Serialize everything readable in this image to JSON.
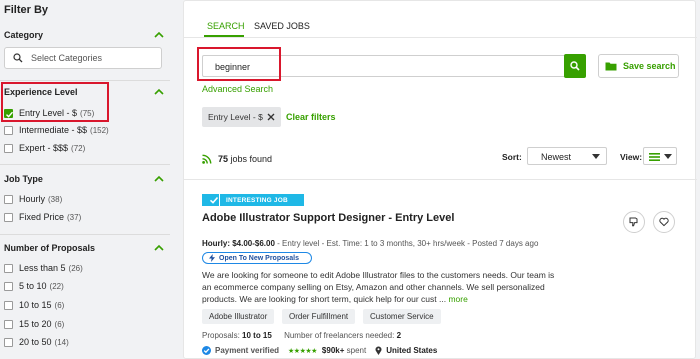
{
  "sidebar": {
    "title": "Filter By",
    "category": {
      "heading": "Category",
      "placeholder": "Select Categories"
    },
    "experience": {
      "heading": "Experience Level",
      "options": [
        {
          "label": "Entry Level - $",
          "count": "(75)",
          "checked": true
        },
        {
          "label": "Intermediate - $$",
          "count": "(152)",
          "checked": false
        },
        {
          "label": "Expert - $$$",
          "count": "(72)",
          "checked": false
        }
      ]
    },
    "job_type": {
      "heading": "Job Type",
      "options": [
        {
          "label": "Hourly",
          "count": "(38)"
        },
        {
          "label": "Fixed Price",
          "count": "(37)"
        }
      ]
    },
    "proposals": {
      "heading": "Number of Proposals",
      "options": [
        {
          "label": "Less than 5",
          "count": "(26)"
        },
        {
          "label": "5 to 10",
          "count": "(22)"
        },
        {
          "label": "10 to 15",
          "count": "(6)"
        },
        {
          "label": "15 to 20",
          "count": "(6)"
        },
        {
          "label": "20 to 50",
          "count": "(14)"
        }
      ]
    }
  },
  "tabs": {
    "search": "SEARCH",
    "saved_jobs": "SAVED JOBS"
  },
  "search": {
    "value": "beginner",
    "save_label": "Save search",
    "advanced_label": "Advanced Search"
  },
  "filters": {
    "chip_label": "Entry Level - $",
    "clear_label": "Clear filters"
  },
  "results": {
    "count": "75",
    "count_suffix": "jobs found",
    "sort_label": "Sort:",
    "sort_value": "Newest",
    "view_label": "View:"
  },
  "job": {
    "badge": "INTERESTING JOB",
    "title": "Adobe Illustrator Support Designer - Entry Level",
    "rate": "Hourly: $4.00-$6.00",
    "meta": " - Entry level - Est. Time: 1 to 3 months, 30+ hrs/week - Posted 7 days ago",
    "proposal_chip": "Open To New Proposals",
    "desc_lines": [
      "We are looking for someone to edit Adobe Illustrator files to the customers needs. Our team is",
      "an ecommerce company selling on Etsy, Amazon and other channels. We sell personalized",
      "products. We are looking for short term, quick help for our cust ..."
    ],
    "more_label": "more",
    "skills": [
      "Adobe Illustrator",
      "Order Fulfillment",
      "Customer Service"
    ],
    "proposals_label": "Proposals:",
    "proposals_value": "10 to 15",
    "freelancers_label": "Number of freelancers needed:",
    "freelancers_value": "2",
    "payment_label": "Payment verified",
    "stars": "★★★★★",
    "spent_value": "$90k+",
    "spent_label": "spent",
    "location": "United States"
  },
  "colors": {
    "accent": "#37a000",
    "highlight_border": "#d9172d",
    "badge": "#1fb8e6"
  }
}
